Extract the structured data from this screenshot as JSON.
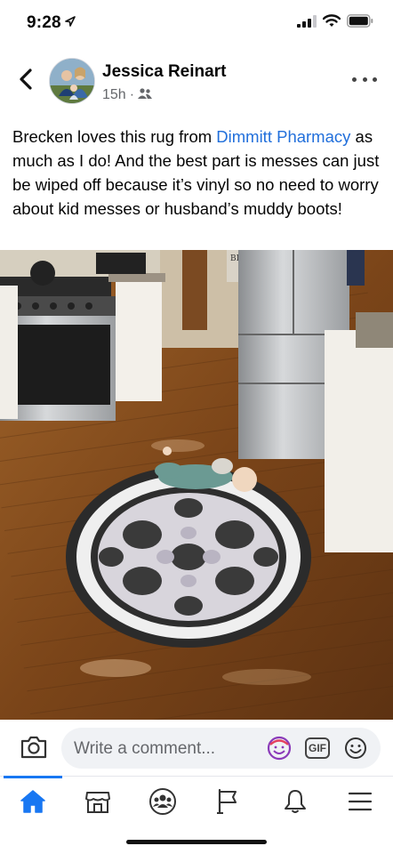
{
  "status_bar": {
    "time": "9:28",
    "icons": [
      "location-arrow-icon",
      "signal-icon",
      "wifi-icon",
      "battery-icon"
    ]
  },
  "post": {
    "author": "Jessica Reinart",
    "time_ago": "15h",
    "separator": "·",
    "audience_icon": "friends-icon",
    "text_before_link": "Brecken loves this rug from ",
    "link_text": "Dimmitt Pharmacy",
    "text_after_link": " as much as I do! And the best part is messes can just be wiped off because it’s vinyl so no need to worry about kid messes or husband’s muddy boots!",
    "photo_sign_text": "BLESS"
  },
  "comment_bar": {
    "placeholder": "Write a comment...",
    "gif_label": "GIF",
    "icons": [
      "camera-icon",
      "avatar-sticker-icon",
      "gif-icon",
      "emoji-icon"
    ]
  },
  "tab_bar": {
    "tabs": [
      "home-icon",
      "marketplace-icon",
      "groups-icon",
      "pages-flag-icon",
      "notifications-bell-icon",
      "menu-icon"
    ],
    "active_tab": "home",
    "accent_color": "#1877f2"
  },
  "colors": {
    "link": "#216fdb",
    "meta_text": "#65676b",
    "input_bg": "#f0f2f5"
  }
}
